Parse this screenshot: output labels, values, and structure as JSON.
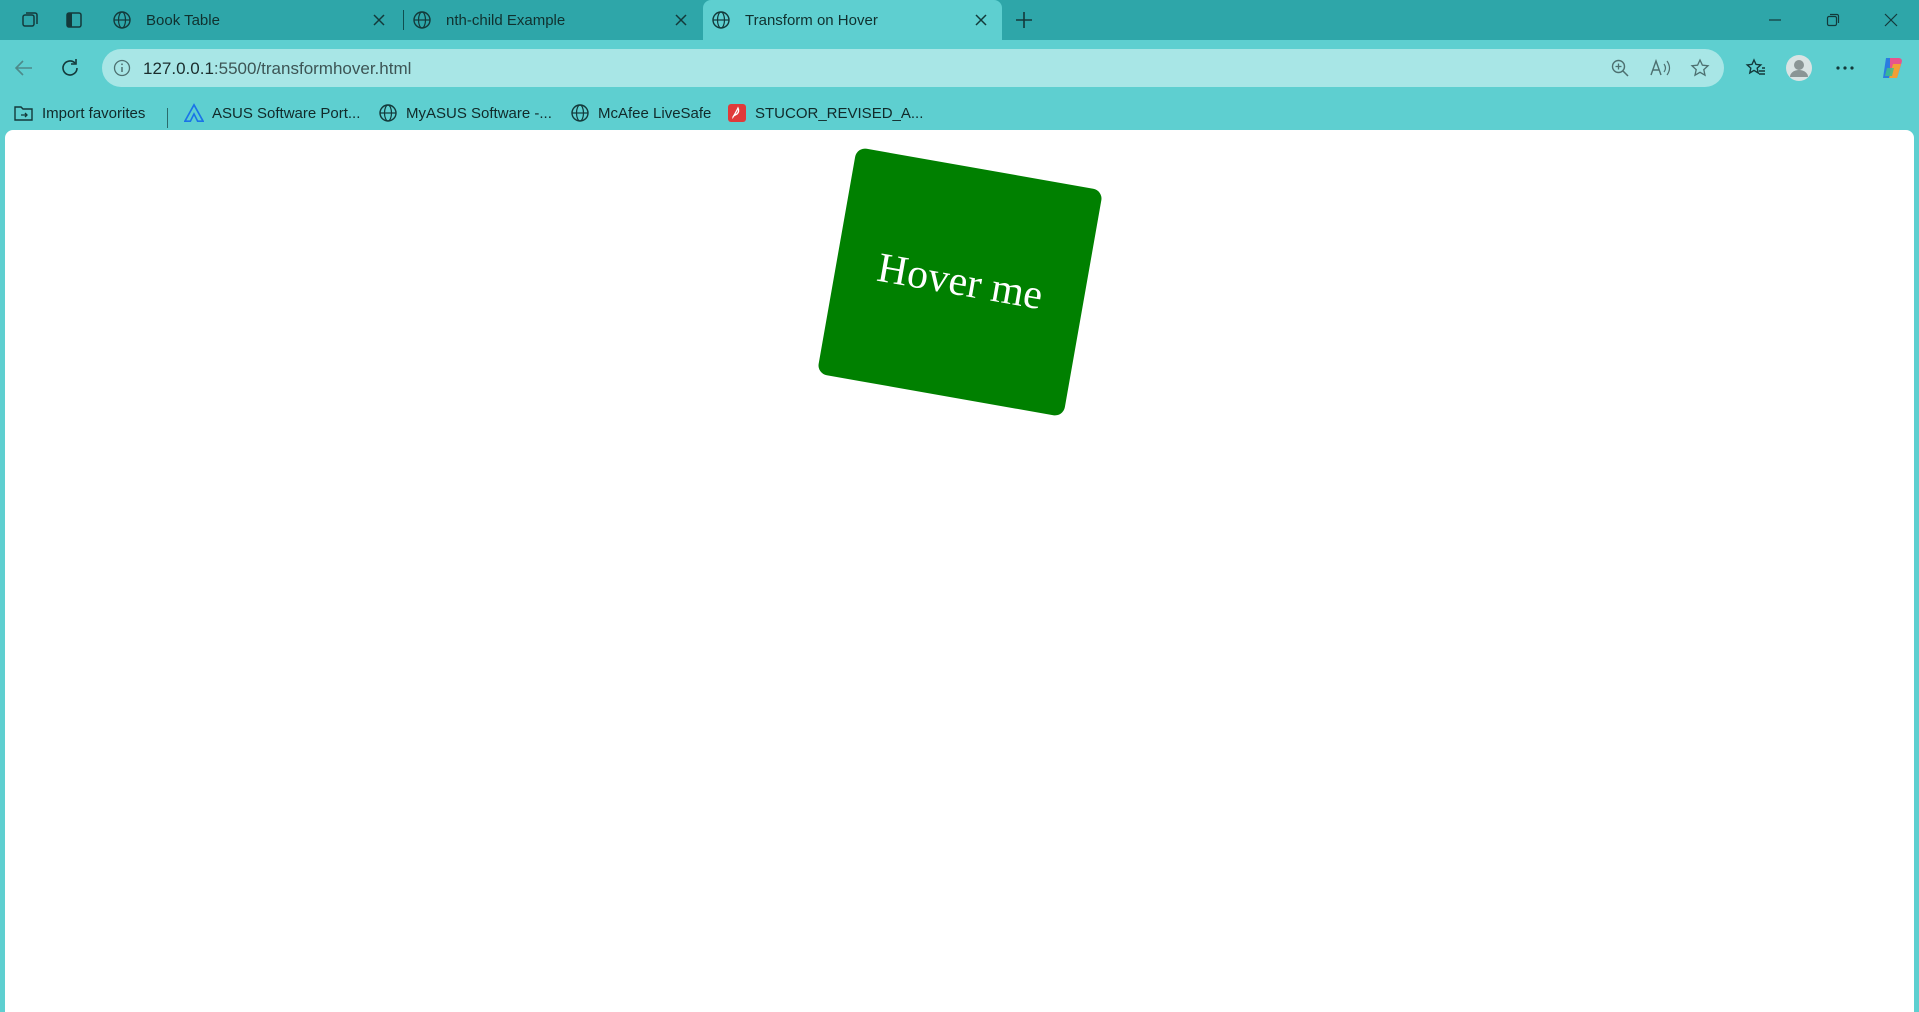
{
  "browser": {
    "tabs": [
      {
        "title": "Book Table",
        "active": false
      },
      {
        "title": "nth-child Example",
        "active": false
      },
      {
        "title": "Transform on Hover",
        "active": true
      }
    ],
    "url_host": "127.0.0.1",
    "url_path": ":5500/transformhover.html",
    "bookmarks": [
      {
        "label": "Import favorites",
        "icon": "import-folder-icon"
      },
      {
        "label": "ASUS Software Port...",
        "icon": "asus-logo-icon"
      },
      {
        "label": "MyASUS Software -...",
        "icon": "globe-icon"
      },
      {
        "label": "McAfee LiveSafe",
        "icon": "globe-icon"
      },
      {
        "label": "STUCOR_REVISED_A...",
        "icon": "pdf-icon"
      }
    ]
  },
  "page": {
    "box_label": "Hover me",
    "box_color": "#008000",
    "box_rotation_deg": 10
  },
  "colors": {
    "tabbar": "#2ea6a9",
    "frame": "#5ecfd0",
    "omnibox": "#a8e6e6",
    "page_bg": "#ffffff"
  }
}
